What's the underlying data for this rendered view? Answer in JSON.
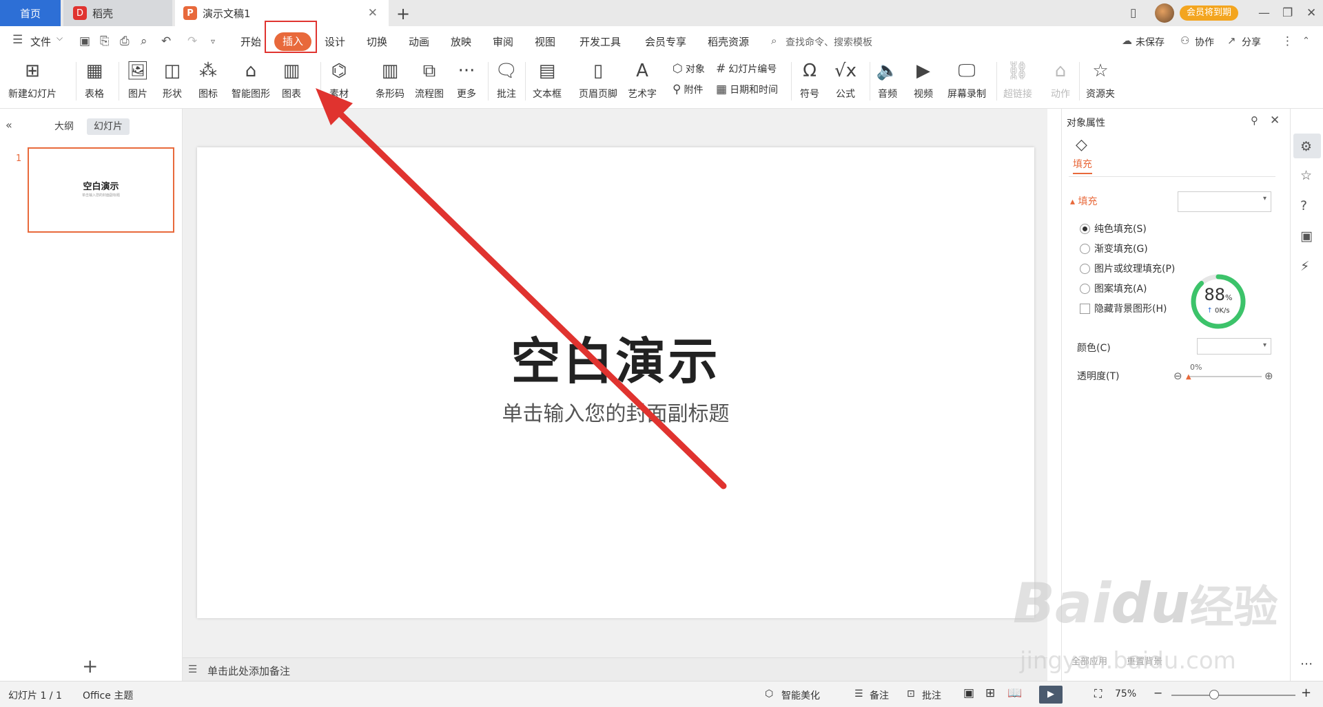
{
  "tabs": {
    "home": "首页",
    "docer": "稻壳",
    "doc_title": "演示文稿1"
  },
  "topbar": {
    "vip_label": "会员将到期"
  },
  "menu": {
    "file": "文件",
    "items": [
      "开始",
      "插入",
      "设计",
      "切换",
      "动画",
      "放映",
      "审阅",
      "视图",
      "开发工具",
      "会员专享",
      "稻壳资源"
    ],
    "active": "插入",
    "search_placeholder": "查找命令、搜索模板",
    "unsaved": "未保存",
    "collaborate": "协作",
    "share": "分享"
  },
  "ribbon": {
    "new_slide": "新建幻灯片",
    "table": "表格",
    "picture": "图片",
    "shape": "形状",
    "icon": "图标",
    "smart_graphic": "智能图形",
    "chart": "图表",
    "material": "素材",
    "barcode": "条形码",
    "flowchart": "流程图",
    "more": "更多",
    "comment": "批注",
    "textbox": "文本框",
    "header_footer": "页眉页脚",
    "wordart": "艺术字",
    "object": "对象",
    "attachment": "附件",
    "slide_number": "幻灯片编号",
    "datetime": "日期和时间",
    "symbol": "符号",
    "formula": "公式",
    "audio": "音频",
    "video": "视频",
    "screen_record": "屏幕录制",
    "hyperlink": "超链接",
    "action": "动作",
    "resource": "资源夹"
  },
  "left_panel": {
    "outline_tab": "大纲",
    "slides_tab": "幻灯片",
    "slide_index": "1",
    "thumb_title": "空白演示",
    "thumb_sub": "单击输入您的封面副标题"
  },
  "slide": {
    "title": "空白演示",
    "subtitle": "单击输入您的封面副标题"
  },
  "notes_placeholder": "单击此处添加备注",
  "right_panel": {
    "title": "对象属性",
    "tab_fill": "填充",
    "section_fill": "填充",
    "options": [
      "纯色填充(S)",
      "渐变填充(G)",
      "图片或纹理填充(P)",
      "图案填充(A)"
    ],
    "hide_bg": "隐藏背景图形(H)",
    "color_label": "颜色(C)",
    "transparency_label": "透明度(T)",
    "transparency_value": "0%"
  },
  "gauge": {
    "percent": "88",
    "unit": "%",
    "speed": "0K/s"
  },
  "status": {
    "slide_info": "幻灯片 1 / 1",
    "theme": "Office 主题",
    "beautify": "智能美化",
    "notes": "备注",
    "comments": "批注",
    "zoom": "75%"
  },
  "watermark": {
    "logo": "Bai",
    "logo2": "du",
    "cn": "经验",
    "url": "jingyan.baidu.com"
  },
  "colors": {
    "accent": "#e8693b",
    "home_tab": "#2d6fd6",
    "annotation_red": "#e0332f",
    "vip": "#f3a51f",
    "gauge_green": "#3cc36a"
  }
}
